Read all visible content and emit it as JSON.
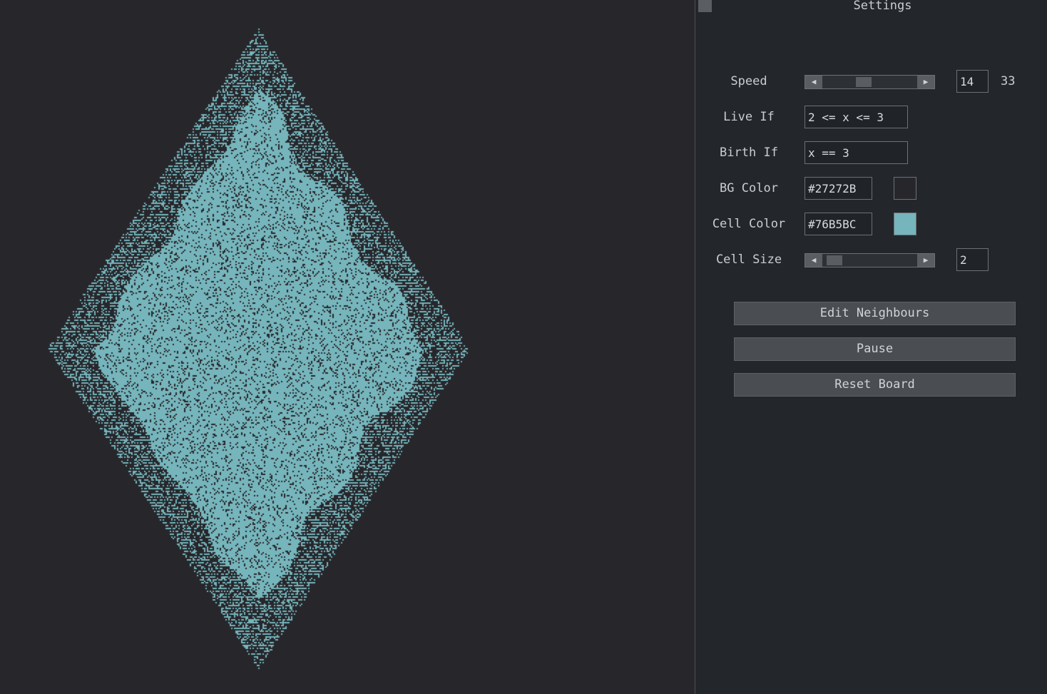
{
  "board": {
    "bg_color": "#27272B",
    "cell_color": "#76B5BC",
    "cell_size": 2
  },
  "panel": {
    "title": "Settings",
    "speed": {
      "label": "Speed",
      "value": "14",
      "max": "33",
      "fraction": 0.42
    },
    "live_if": {
      "label": "Live If",
      "value": "2 <= x <= 3"
    },
    "birth_if": {
      "label": "Birth If",
      "value": "x == 3"
    },
    "bg_color": {
      "label": "BG Color",
      "value": "#27272B",
      "swatch": "#27272B"
    },
    "cell_color": {
      "label": "Cell Color",
      "value": "#76B5BC",
      "swatch": "#76B5BC"
    },
    "cell_size": {
      "label": "Cell Size",
      "value": "2",
      "fraction": 0.05
    },
    "buttons": {
      "edit_neighbours": "Edit Neighbours",
      "pause": "Pause",
      "reset_board": "Reset Board"
    },
    "icons": {
      "left_arrow": "◀",
      "right_arrow": "▶"
    }
  }
}
